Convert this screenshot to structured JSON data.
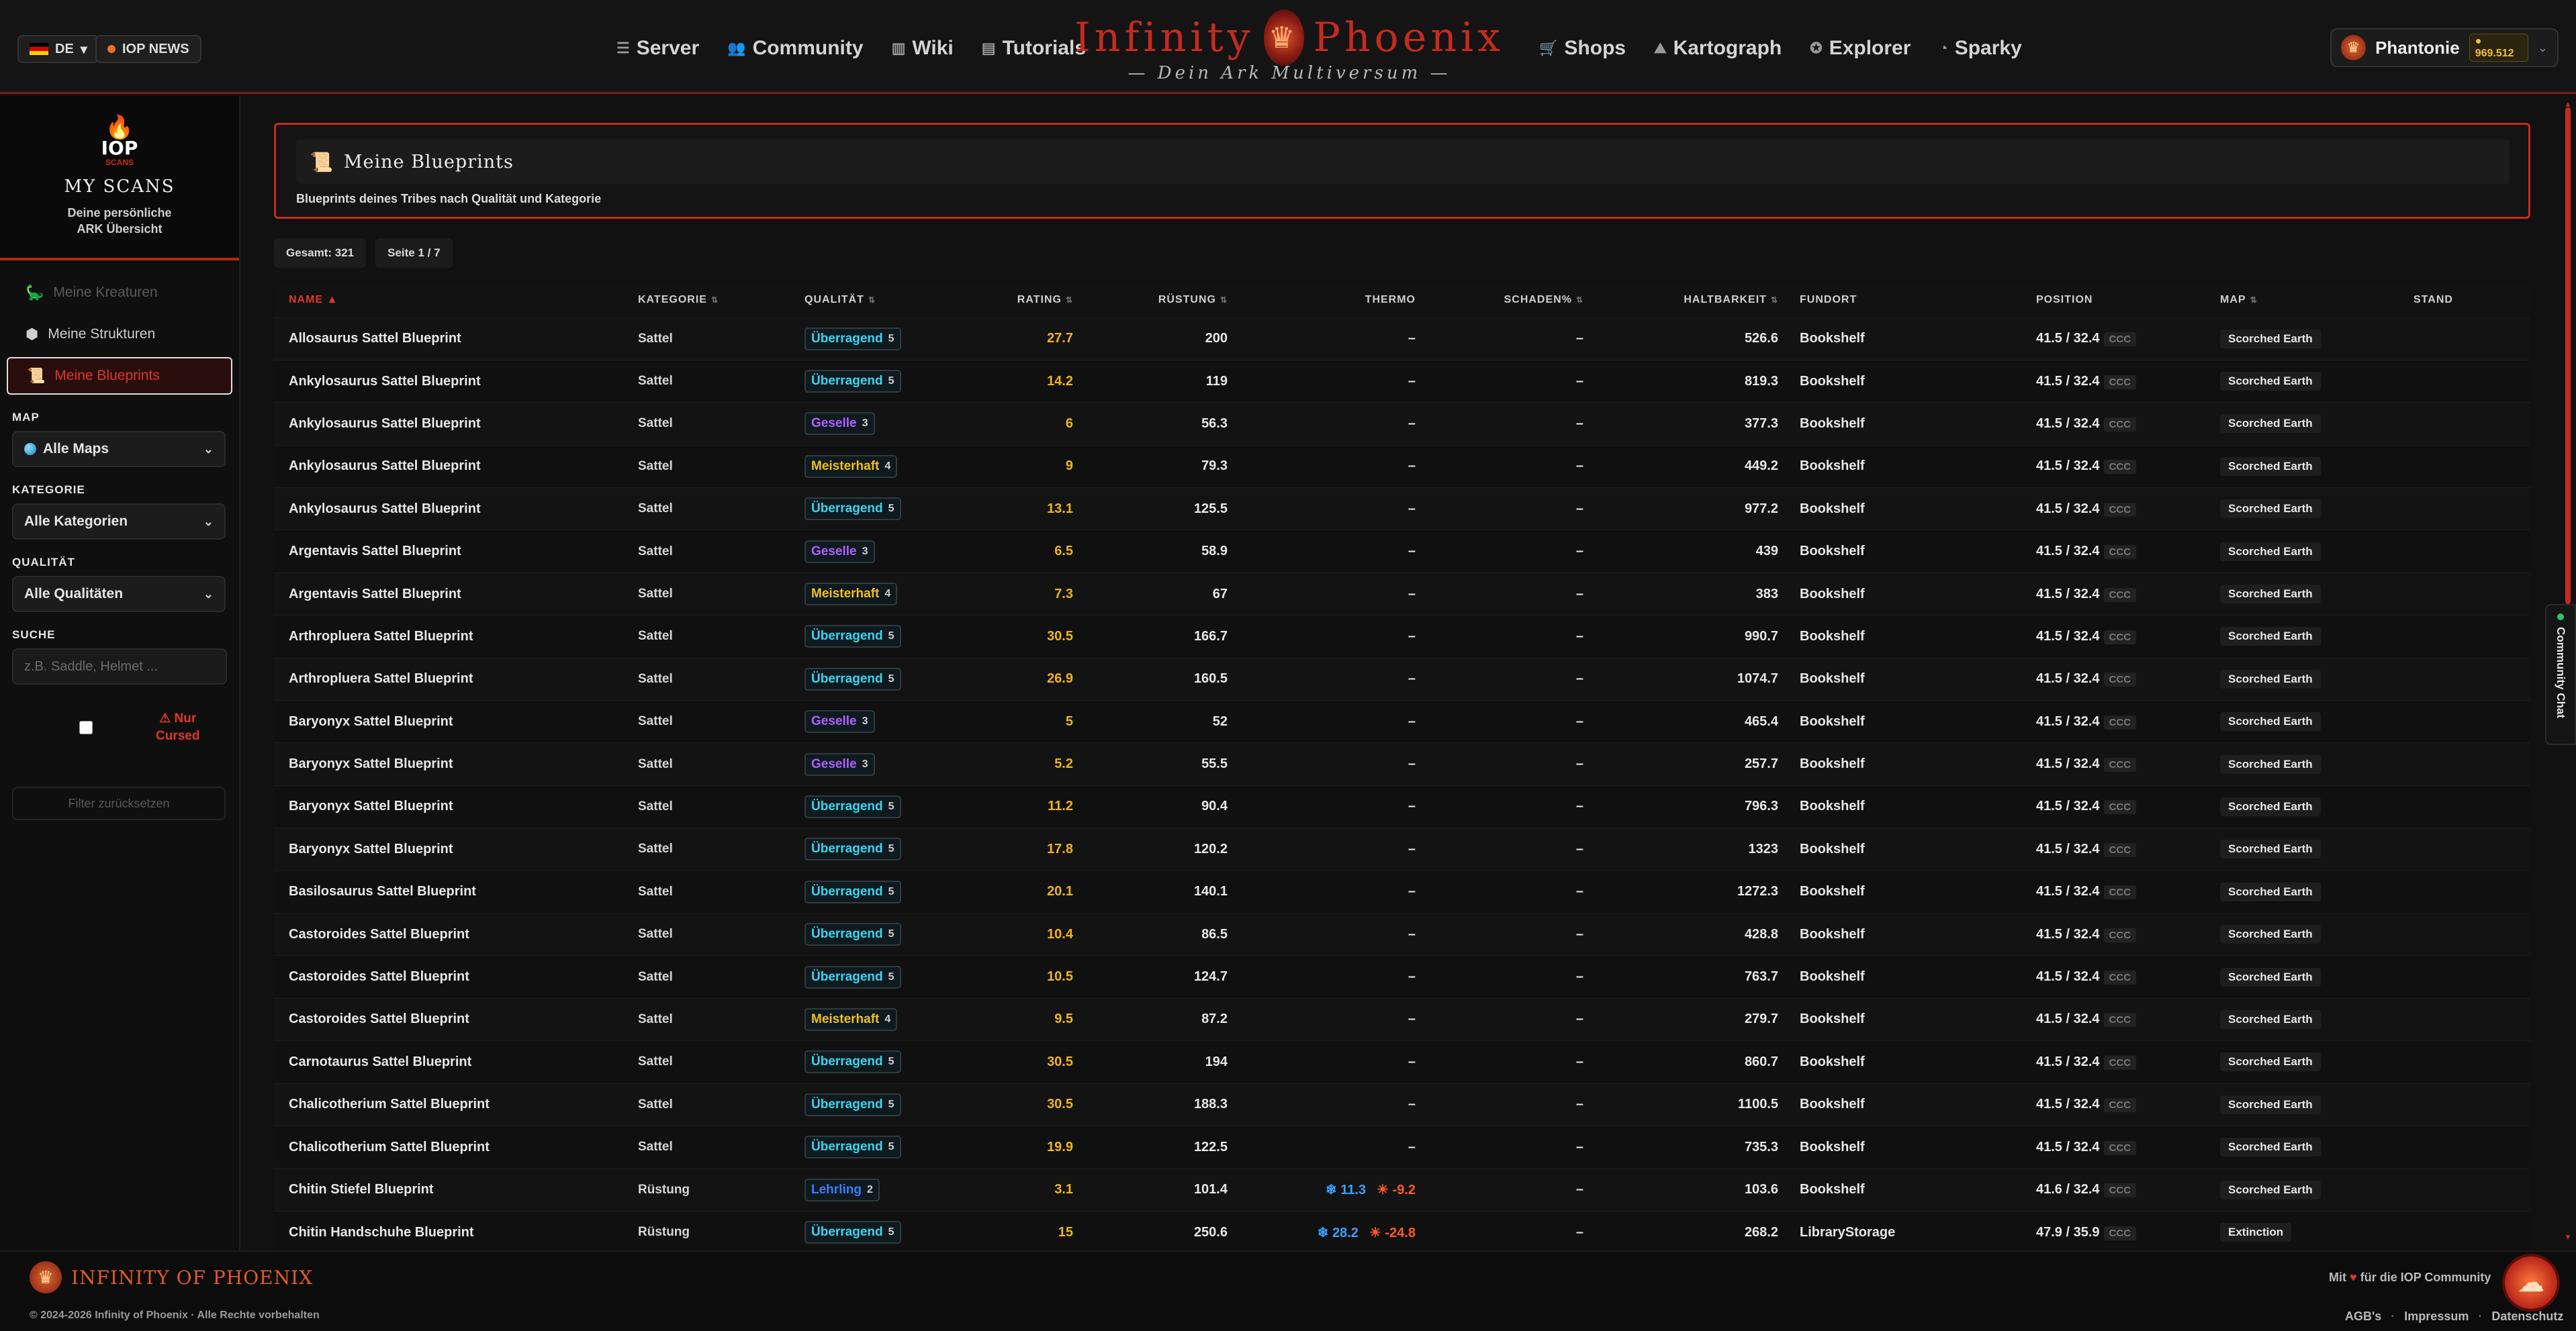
{
  "header": {
    "lang": "DE",
    "news": "IOP NEWS",
    "nav_left": [
      "Server",
      "Community",
      "Wiki",
      "Tutorials"
    ],
    "nav_right": [
      "Shops",
      "Kartograph",
      "Explorer",
      "Sparky"
    ],
    "brand_left": "Infinity",
    "brand_right": "Phoenix",
    "brand_sub": "— Dein Ark Multiversum —",
    "user": "Phantonie",
    "coins": "969.512"
  },
  "sidebar": {
    "logo": "IOP",
    "logo_small": "SCANS",
    "title": "MY SCANS",
    "desc1": "Deine persönliche",
    "desc2": "ARK Übersicht",
    "menu": [
      "Meine Kreaturen",
      "Meine Strukturen",
      "Meine Blueprints"
    ],
    "filters": {
      "map_label": "MAP",
      "map_value": "Alle Maps",
      "cat_label": "KATEGORIE",
      "cat_value": "Alle Kategorien",
      "qual_label": "QUALITÄT",
      "qual_value": "Alle Qualitäten",
      "search_label": "SUCHE",
      "search_placeholder": "z.B. Saddle, Helmet ...",
      "cursed_1": "⚠ Nur",
      "cursed_2": "Cursed",
      "reset": "Filter zurücksetzen"
    }
  },
  "main": {
    "title": "Meine Blueprints",
    "subtitle": "Blueprints deines Tribes nach Qualität und Kategorie",
    "total": "Gesamt: 321",
    "page": "Seite 1 / 7",
    "columns": [
      "NAME",
      "KATEGORIE",
      "QUALITÄT",
      "RATING",
      "RÜSTUNG",
      "THERMO",
      "SCHADEN%",
      "HALTBARKEIT",
      "FUNDORT",
      "POSITION",
      "MAP",
      "STAND"
    ],
    "rows": [
      {
        "name": "Allosaurus Sattel Blueprint",
        "cat": "Sattel",
        "q": "Überragend",
        "qn": "5",
        "rating": "27.7",
        "armor": "200",
        "thermo": "–",
        "dmg": "–",
        "dur": "526.6",
        "loc": "Bookshelf",
        "pos": "41.5 / 32.4",
        "code": "CCC",
        "map": "Scorched Earth"
      },
      {
        "name": "Ankylosaurus Sattel Blueprint",
        "cat": "Sattel",
        "q": "Überragend",
        "qn": "5",
        "rating": "14.2",
        "armor": "119",
        "thermo": "–",
        "dmg": "–",
        "dur": "819.3",
        "loc": "Bookshelf",
        "pos": "41.5 / 32.4",
        "code": "CCC",
        "map": "Scorched Earth"
      },
      {
        "name": "Ankylosaurus Sattel Blueprint",
        "cat": "Sattel",
        "q": "Geselle",
        "qn": "3",
        "rating": "6",
        "armor": "56.3",
        "thermo": "–",
        "dmg": "–",
        "dur": "377.3",
        "loc": "Bookshelf",
        "pos": "41.5 / 32.4",
        "code": "CCC",
        "map": "Scorched Earth"
      },
      {
        "name": "Ankylosaurus Sattel Blueprint",
        "cat": "Sattel",
        "q": "Meisterhaft",
        "qn": "4",
        "rating": "9",
        "armor": "79.3",
        "thermo": "–",
        "dmg": "–",
        "dur": "449.2",
        "loc": "Bookshelf",
        "pos": "41.5 / 32.4",
        "code": "CCC",
        "map": "Scorched Earth"
      },
      {
        "name": "Ankylosaurus Sattel Blueprint",
        "cat": "Sattel",
        "q": "Überragend",
        "qn": "5",
        "rating": "13.1",
        "armor": "125.5",
        "thermo": "–",
        "dmg": "–",
        "dur": "977.2",
        "loc": "Bookshelf",
        "pos": "41.5 / 32.4",
        "code": "CCC",
        "map": "Scorched Earth"
      },
      {
        "name": "Argentavis Sattel Blueprint",
        "cat": "Sattel",
        "q": "Geselle",
        "qn": "3",
        "rating": "6.5",
        "armor": "58.9",
        "thermo": "–",
        "dmg": "–",
        "dur": "439",
        "loc": "Bookshelf",
        "pos": "41.5 / 32.4",
        "code": "CCC",
        "map": "Scorched Earth"
      },
      {
        "name": "Argentavis Sattel Blueprint",
        "cat": "Sattel",
        "q": "Meisterhaft",
        "qn": "4",
        "rating": "7.3",
        "armor": "67",
        "thermo": "–",
        "dmg": "–",
        "dur": "383",
        "loc": "Bookshelf",
        "pos": "41.5 / 32.4",
        "code": "CCC",
        "map": "Scorched Earth"
      },
      {
        "name": "Arthropluera Sattel Blueprint",
        "cat": "Sattel",
        "q": "Überragend",
        "qn": "5",
        "rating": "30.5",
        "armor": "166.7",
        "thermo": "–",
        "dmg": "–",
        "dur": "990.7",
        "loc": "Bookshelf",
        "pos": "41.5 / 32.4",
        "code": "CCC",
        "map": "Scorched Earth"
      },
      {
        "name": "Arthropluera Sattel Blueprint",
        "cat": "Sattel",
        "q": "Überragend",
        "qn": "5",
        "rating": "26.9",
        "armor": "160.5",
        "thermo": "–",
        "dmg": "–",
        "dur": "1074.7",
        "loc": "Bookshelf",
        "pos": "41.5 / 32.4",
        "code": "CCC",
        "map": "Scorched Earth"
      },
      {
        "name": "Baryonyx Sattel Blueprint",
        "cat": "Sattel",
        "q": "Geselle",
        "qn": "3",
        "rating": "5",
        "armor": "52",
        "thermo": "–",
        "dmg": "–",
        "dur": "465.4",
        "loc": "Bookshelf",
        "pos": "41.5 / 32.4",
        "code": "CCC",
        "map": "Scorched Earth"
      },
      {
        "name": "Baryonyx Sattel Blueprint",
        "cat": "Sattel",
        "q": "Geselle",
        "qn": "3",
        "rating": "5.2",
        "armor": "55.5",
        "thermo": "–",
        "dmg": "–",
        "dur": "257.7",
        "loc": "Bookshelf",
        "pos": "41.5 / 32.4",
        "code": "CCC",
        "map": "Scorched Earth"
      },
      {
        "name": "Baryonyx Sattel Blueprint",
        "cat": "Sattel",
        "q": "Überragend",
        "qn": "5",
        "rating": "11.2",
        "armor": "90.4",
        "thermo": "–",
        "dmg": "–",
        "dur": "796.3",
        "loc": "Bookshelf",
        "pos": "41.5 / 32.4",
        "code": "CCC",
        "map": "Scorched Earth"
      },
      {
        "name": "Baryonyx Sattel Blueprint",
        "cat": "Sattel",
        "q": "Überragend",
        "qn": "5",
        "rating": "17.8",
        "armor": "120.2",
        "thermo": "–",
        "dmg": "–",
        "dur": "1323",
        "loc": "Bookshelf",
        "pos": "41.5 / 32.4",
        "code": "CCC",
        "map": "Scorched Earth"
      },
      {
        "name": "Basilosaurus Sattel Blueprint",
        "cat": "Sattel",
        "q": "Überragend",
        "qn": "5",
        "rating": "20.1",
        "armor": "140.1",
        "thermo": "–",
        "dmg": "–",
        "dur": "1272.3",
        "loc": "Bookshelf",
        "pos": "41.5 / 32.4",
        "code": "CCC",
        "map": "Scorched Earth"
      },
      {
        "name": "Castoroides Sattel Blueprint",
        "cat": "Sattel",
        "q": "Überragend",
        "qn": "5",
        "rating": "10.4",
        "armor": "86.5",
        "thermo": "–",
        "dmg": "–",
        "dur": "428.8",
        "loc": "Bookshelf",
        "pos": "41.5 / 32.4",
        "code": "CCC",
        "map": "Scorched Earth"
      },
      {
        "name": "Castoroides Sattel Blueprint",
        "cat": "Sattel",
        "q": "Überragend",
        "qn": "5",
        "rating": "10.5",
        "armor": "124.7",
        "thermo": "–",
        "dmg": "–",
        "dur": "763.7",
        "loc": "Bookshelf",
        "pos": "41.5 / 32.4",
        "code": "CCC",
        "map": "Scorched Earth"
      },
      {
        "name": "Castoroides Sattel Blueprint",
        "cat": "Sattel",
        "q": "Meisterhaft",
        "qn": "4",
        "rating": "9.5",
        "armor": "87.2",
        "thermo": "–",
        "dmg": "–",
        "dur": "279.7",
        "loc": "Bookshelf",
        "pos": "41.5 / 32.4",
        "code": "CCC",
        "map": "Scorched Earth"
      },
      {
        "name": "Carnotaurus Sattel Blueprint",
        "cat": "Sattel",
        "q": "Überragend",
        "qn": "5",
        "rating": "30.5",
        "armor": "194",
        "thermo": "–",
        "dmg": "–",
        "dur": "860.7",
        "loc": "Bookshelf",
        "pos": "41.5 / 32.4",
        "code": "CCC",
        "map": "Scorched Earth"
      },
      {
        "name": "Chalicotherium Sattel Blueprint",
        "cat": "Sattel",
        "q": "Überragend",
        "qn": "5",
        "rating": "30.5",
        "armor": "188.3",
        "thermo": "–",
        "dmg": "–",
        "dur": "1100.5",
        "loc": "Bookshelf",
        "pos": "41.5 / 32.4",
        "code": "CCC",
        "map": "Scorched Earth"
      },
      {
        "name": "Chalicotherium Sattel Blueprint",
        "cat": "Sattel",
        "q": "Überragend",
        "qn": "5",
        "rating": "19.9",
        "armor": "122.5",
        "thermo": "–",
        "dmg": "–",
        "dur": "735.3",
        "loc": "Bookshelf",
        "pos": "41.5 / 32.4",
        "code": "CCC",
        "map": "Scorched Earth"
      },
      {
        "name": "Chitin Stiefel Blueprint",
        "cat": "Rüstung",
        "q": "Lehrling",
        "qn": "2",
        "rating": "3.1",
        "armor": "101.4",
        "thermo_cold": "❄ 11.3",
        "thermo_hot": "☀ -9.2",
        "dmg": "–",
        "dur": "103.6",
        "loc": "Bookshelf",
        "pos": "41.6 / 32.4",
        "code": "CCC",
        "map": "Scorched Earth"
      },
      {
        "name": "Chitin Handschuhe Blueprint",
        "cat": "Rüstung",
        "q": "Überragend",
        "qn": "5",
        "rating": "15",
        "armor": "250.6",
        "thermo_cold": "❄ 28.2",
        "thermo_hot": "☀ -24.8",
        "dmg": "–",
        "dur": "268.2",
        "loc": "LibraryStorage",
        "pos": "47.9 / 35.9",
        "code": "CCC",
        "map": "Extinction"
      }
    ]
  },
  "quality_colors": {
    "Überragend": "#3ad6f0",
    "Meisterhaft": "#f0c020",
    "Geselle": "#b060ff",
    "Lehrling": "#3a7dff"
  },
  "chat": "Community Chat",
  "footer": {
    "name": "INFINITY OF PHOENIX",
    "copy": "© 2024-2026 Infinity of Phoenix · Alle Rechte vorbehalten",
    "love_pre": "Mit",
    "love_post": "für die IOP Community",
    "links": [
      "AGB's",
      "Impressum",
      "Datenschutz"
    ]
  }
}
